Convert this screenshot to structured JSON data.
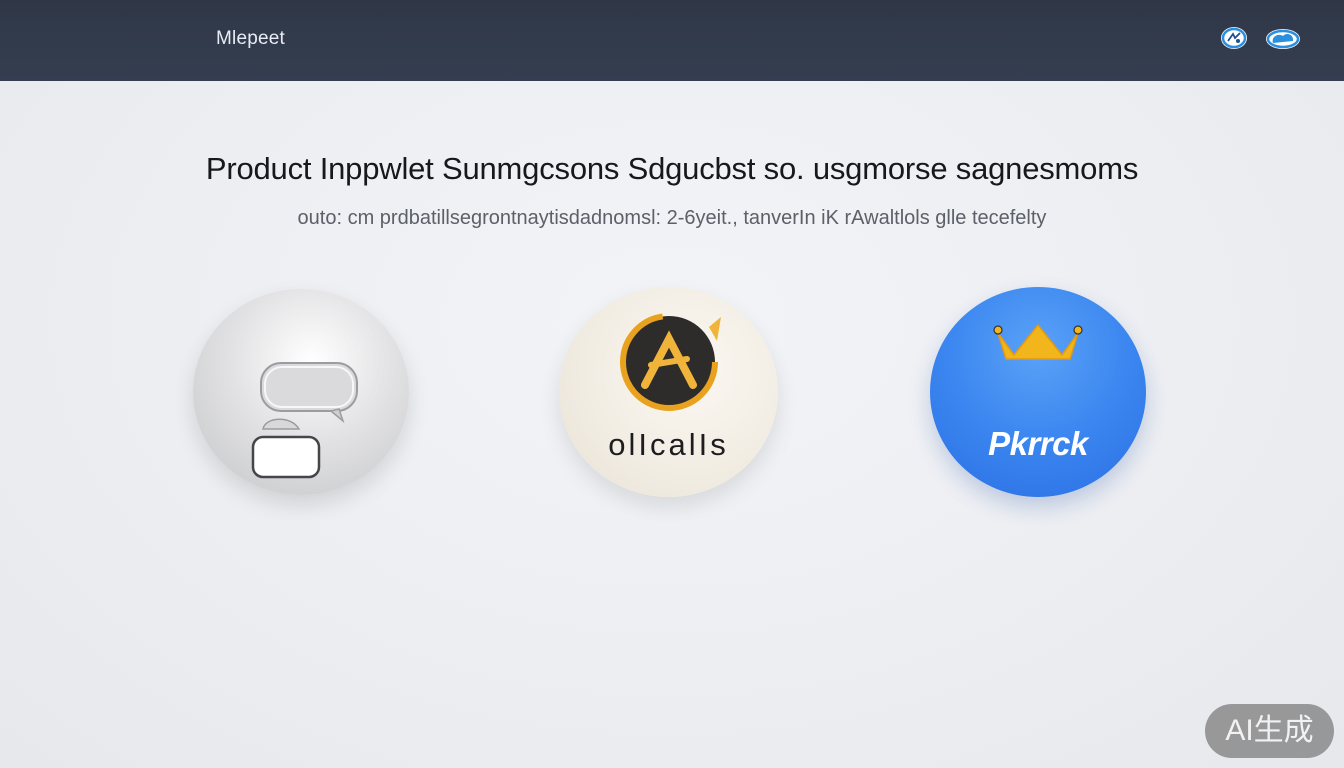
{
  "header": {
    "brand": "Mlepeet",
    "icons": [
      "badge-icon",
      "cloud-icon"
    ]
  },
  "main": {
    "headline": "Product Inppwlet Sunmgcsons Sdgucbst so. usgmorse sagnesmoms",
    "subline": "outo: cm prdbatillsegrontnaytisdadnomsl: 2-6yeit., tanverIn iK rAwaltlols glle tecefelty"
  },
  "tiles": [
    {
      "icon": "chat-bubble-icon"
    },
    {
      "icon": "tools-badge-icon",
      "label": "olIcalIs"
    },
    {
      "icon": "crown-icon",
      "label": "Pkrrck"
    }
  ],
  "watermark": {
    "text": "AI生成"
  },
  "colors": {
    "topbar": "#2f3747",
    "accent_blue": "#3b86f0",
    "crown_gold": "#f2b51c",
    "tools_orange": "#e9a21f"
  }
}
